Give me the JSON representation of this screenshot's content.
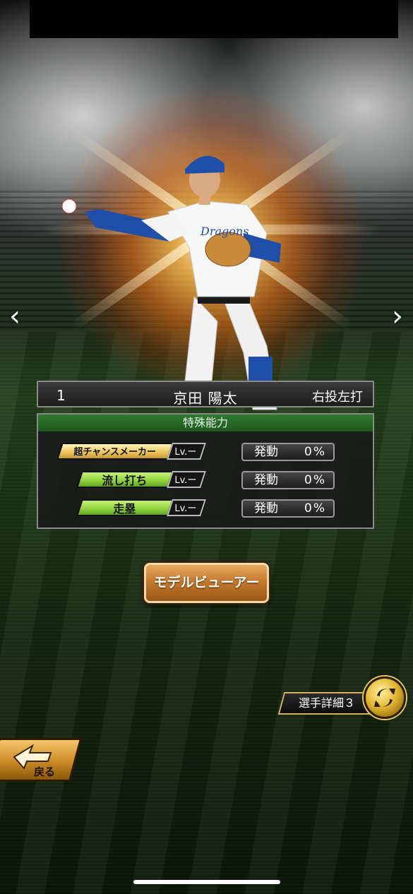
{
  "player": {
    "number": "1",
    "name": "京田 陽太",
    "handedness": "右投左打"
  },
  "abilities": {
    "header": "特殊能力",
    "items": [
      {
        "name": "超チャンスメーカー",
        "badge": "超",
        "style": "gold",
        "level": "Lv.ー",
        "activation_label": "発動",
        "activation_value": "0%"
      },
      {
        "name": "流し打ち",
        "style": "green",
        "level": "Lv.ー",
        "activation_label": "発動",
        "activation_value": "0%"
      },
      {
        "name": "走塁",
        "style": "green",
        "level": "Lv.ー",
        "activation_label": "発動",
        "activation_value": "0%"
      }
    ]
  },
  "buttons": {
    "model_viewer": "モデルビューアー",
    "player_detail": "選手詳細３",
    "back": "戻る"
  },
  "icons": {
    "prev": "chevron-left-icon",
    "next": "chevron-right-icon",
    "swap": "swap-arrows-icon",
    "back": "back-arrow-icon"
  },
  "colors": {
    "ability_header": "#2f7a2f",
    "gold": "#e9c159",
    "green": "#8ed13a",
    "model_button": "#c57a30"
  }
}
